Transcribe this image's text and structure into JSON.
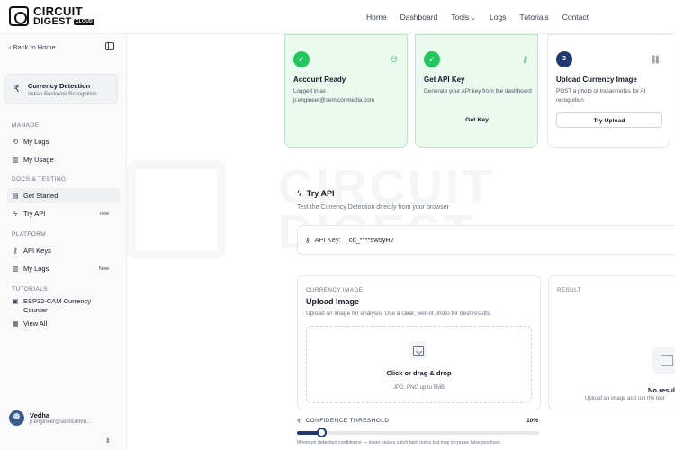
{
  "brand": {
    "line1": "CIRCUIT",
    "line2": "DIGEST",
    "tag": "CLOUD"
  },
  "nav": {
    "items": [
      "Home",
      "Dashboard",
      "Tools",
      "Logs",
      "Tutorials",
      "Contact"
    ],
    "tools_chevron": "⌄"
  },
  "sidebar": {
    "back_label": "Back to Home",
    "project": {
      "icon": "rupee-icon",
      "title": "Currency Detection",
      "subtitle": "Indian Banknote Recognition"
    },
    "sections": {
      "manage": "MANAGE",
      "docs": "DOCS & TESTING",
      "platform": "PLATFORM",
      "tutorials": "TUTORIALS"
    },
    "items": {
      "my_logs": "My Logs",
      "my_usage": "My Usage",
      "get_started": "Get Started",
      "try_api": "Try API",
      "try_api_badge": "new",
      "api_keys": "API Keys",
      "my_logs2": "My Logs",
      "my_logs2_badge": "New",
      "esp32": "ESP32-CAM Currency Counter",
      "view_all": "View All"
    },
    "user": {
      "name": "Vedha",
      "email": "jr.engineer@semicomm..."
    }
  },
  "steps": [
    {
      "title": "Account Ready",
      "desc": "Logged in as jr.engineer@semiconmedia.com",
      "button": "",
      "marker": "✓",
      "icon": "user-check-icon"
    },
    {
      "title": "Get API Key",
      "desc": "Generate your API key from the dashboard",
      "button": "Get Key",
      "marker": "✓",
      "icon": "key-icon"
    },
    {
      "title": "Upload Currency Image",
      "desc": "POST a photo of Indian notes for AI recognition",
      "button": "Try Upload",
      "marker": "3",
      "icon": "link-icon"
    }
  ],
  "try_api": {
    "title": "Try API",
    "subtitle": "Test the Currency Detection directly from your browser",
    "key_label": "API Key:",
    "key_value": "cd_****sw5yR7"
  },
  "upload": {
    "label": "CURRENCY IMAGE",
    "title": "Upload Image",
    "desc": "Upload an image for analysis. Use a clear, well-lit photo for best results.",
    "dz_title": "Click or drag & drop",
    "dz_sub": "JPG, PNG up to 5MB"
  },
  "result": {
    "label": "RESULT",
    "title": "No resul",
    "sub": "Upload an image and run the test"
  },
  "confidence": {
    "label": "CONFIDENCE THRESHOLD",
    "value_text": "10%",
    "value": 0.1,
    "help": "Minimum detection confidence — lower values catch faint notes but may increase false positives"
  },
  "colors": {
    "accent": "#1e3a6e",
    "success": "#22c55e",
    "success_bg": "#eafaee"
  }
}
